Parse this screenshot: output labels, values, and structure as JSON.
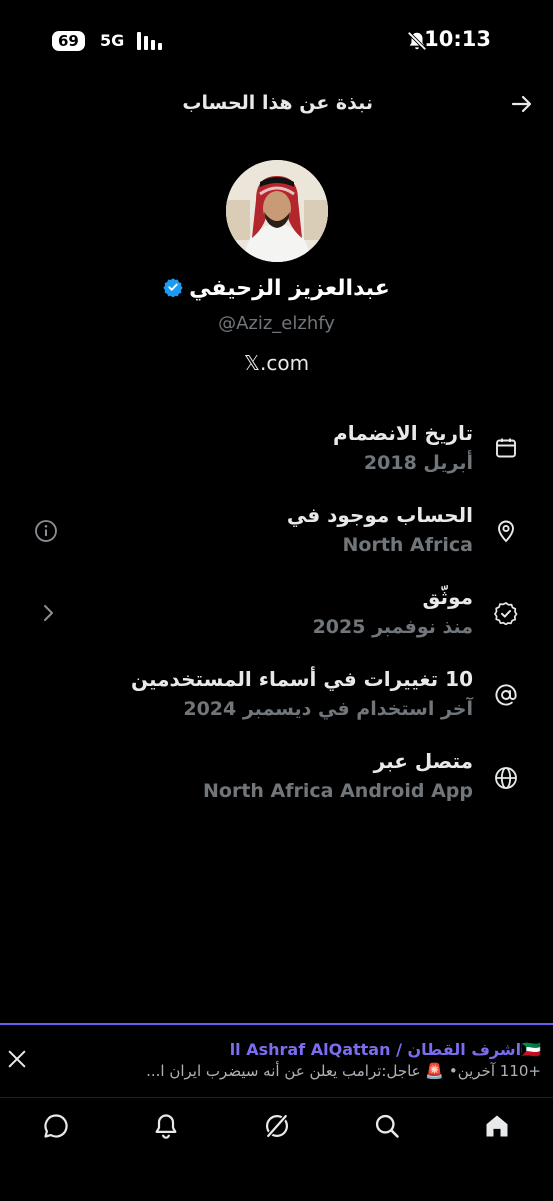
{
  "status_bar": {
    "battery": "69",
    "network": "5G",
    "time": "10:13"
  },
  "header": {
    "title": "نبذة عن هذا الحساب"
  },
  "profile": {
    "display_name": "عبدالعزيز الزحيفي",
    "handle": "@Aziz_elzhfy",
    "site": "𝕏.com"
  },
  "rows": [
    {
      "title": "تاريخ الانضمام",
      "subtitle": "أبريل 2018",
      "icon": "calendar-icon"
    },
    {
      "title": "الحساب موجود في",
      "subtitle": "North Africa",
      "icon": "location-pin-icon"
    },
    {
      "title": "موثّق",
      "subtitle": "منذ نوفمبر 2025",
      "icon": "verified-badge-icon"
    },
    {
      "title": "10 تغييرات في أسماء المستخدمين",
      "subtitle": "آخر استخدام في ديسمبر 2024",
      "icon": "at-sign-icon"
    },
    {
      "title": "متصل عبر",
      "subtitle": "North Africa Android App",
      "icon": "globe-icon"
    }
  ],
  "notification": {
    "title": "اا Ashraf AlQattan / اشرف القطان🇰🇼",
    "text": "+110 آخرين• 🚨 عاجل:ترامب يعلن عن أنه سيضرب ايران ا..."
  },
  "colors": {
    "background": "#000000",
    "primary_text": "#e7e9ea",
    "secondary_text": "#71767b",
    "verified": "#1d9bf0",
    "accent": "#6b5cf6"
  }
}
